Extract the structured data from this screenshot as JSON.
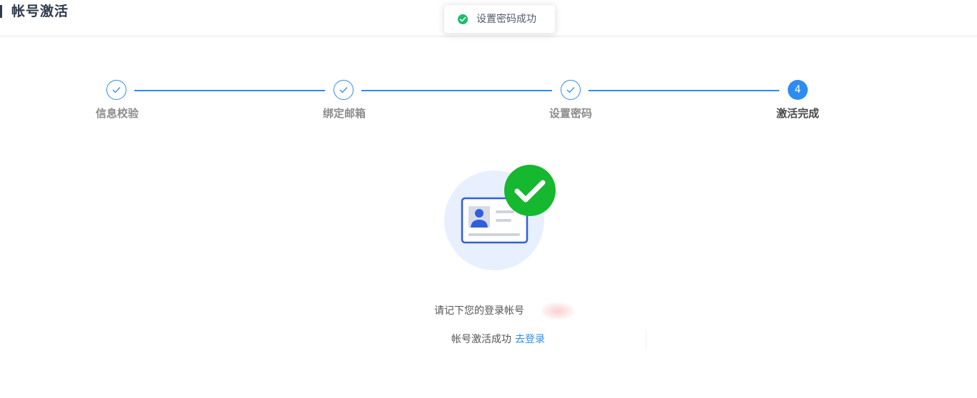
{
  "header": {
    "title": "帐号激活"
  },
  "toast": {
    "message": "设置密码成功",
    "icon": "success-check-icon",
    "color": "#19be6b"
  },
  "steps": [
    {
      "label": "信息校验",
      "status": "finished"
    },
    {
      "label": "绑定邮箱",
      "status": "finished"
    },
    {
      "label": "设置密码",
      "status": "finished"
    },
    {
      "label": "激活完成",
      "status": "active",
      "number": "4"
    }
  ],
  "colors": {
    "primary": "#2d8cf0",
    "success": "#19be6b",
    "illustration_bg": "#e8efff",
    "card_border": "#2f5fe0"
  },
  "result": {
    "remember_text": "请记下您的登录帐号",
    "success_text": "帐号激活成功",
    "login_link": "去登录"
  }
}
